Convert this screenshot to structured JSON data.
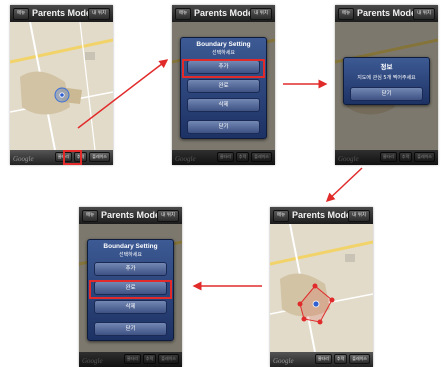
{
  "title": "Parents Mode",
  "left_button": "메뉴",
  "right_button": "내 위치",
  "google": "Google",
  "bottom_buttons": [
    "울타리",
    "추적",
    "플레이스"
  ],
  "boundary_dialog": {
    "title": "Boundary Setting",
    "subtitle": "선택하세요",
    "buttons": [
      "추가",
      "완료",
      "삭제",
      "닫기"
    ]
  },
  "info_dialog": {
    "title": "정보",
    "message": "지도에 관심 5개 찍어주세요",
    "button": "닫기"
  },
  "colors": {
    "highlight": "#e12b2b",
    "arrow": "#e12b2b",
    "dialog": "#23386c"
  }
}
